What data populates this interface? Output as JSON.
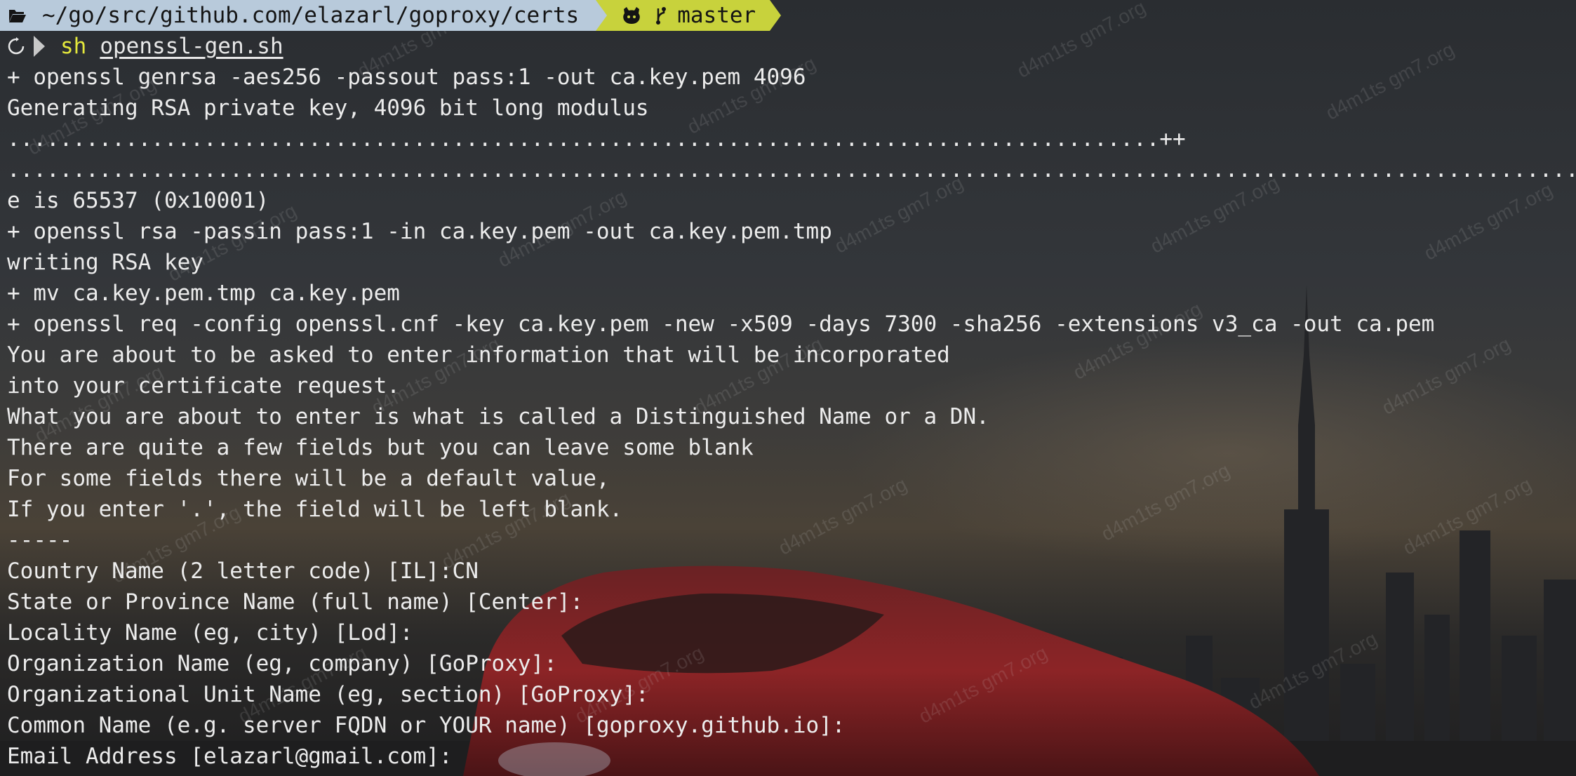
{
  "prompt": {
    "path": "~/go/src/github.com/elazarl/goproxy/certs",
    "branch": "master",
    "folder_icon": "folder-open-icon",
    "git_icon": "github-octocat-icon",
    "branch_icon": "git-branch-icon"
  },
  "command": {
    "name": "sh",
    "arg": "openssl-gen.sh"
  },
  "output": [
    "+ openssl genrsa -aes256 -passout pass:1 -out ca.key.pem 4096",
    "Generating RSA private key, 4096 bit long modulus",
    "........................................................................................++",
    ".......................................................................................................................................................++",
    "e is 65537 (0x10001)",
    "+ openssl rsa -passin pass:1 -in ca.key.pem -out ca.key.pem.tmp",
    "writing RSA key",
    "+ mv ca.key.pem.tmp ca.key.pem",
    "+ openssl req -config openssl.cnf -key ca.key.pem -new -x509 -days 7300 -sha256 -extensions v3_ca -out ca.pem",
    "You are about to be asked to enter information that will be incorporated",
    "into your certificate request.",
    "What you are about to enter is what is called a Distinguished Name or a DN.",
    "There are quite a few fields but you can leave some blank",
    "For some fields there will be a default value,",
    "If you enter '.', the field will be left blank.",
    "-----",
    "Country Name (2 letter code) [IL]:CN",
    "State or Province Name (full name) [Center]:",
    "Locality Name (eg, city) [Lod]:",
    "Organization Name (eg, company) [GoProxy]:",
    "Organizational Unit Name (eg, section) [GoProxy]:",
    "Common Name (e.g. server FQDN or YOUR name) [goproxy.github.io]:",
    "Email Address [elazarl@gmail.com]:"
  ],
  "watermark": "d4m1ts gm7.org"
}
